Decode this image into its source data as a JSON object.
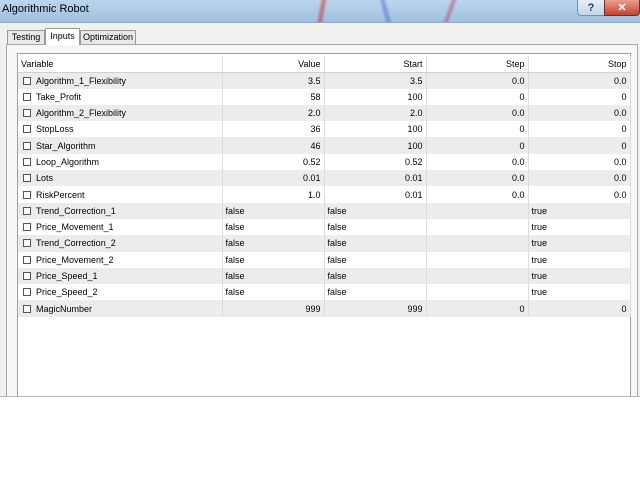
{
  "window": {
    "title": "Algorithmic Robot",
    "help_label": "?",
    "close_label": "✕"
  },
  "tabs": [
    {
      "label": "Testing",
      "active": false
    },
    {
      "label": "Inputs",
      "active": true
    },
    {
      "label": "Optimization",
      "active": false
    }
  ],
  "table": {
    "headers": [
      "Variable",
      "Value",
      "Start",
      "Step",
      "Stop"
    ],
    "rows": [
      {
        "variable": "Algorithm_1_Flexibility",
        "value": "3.5",
        "start": "3.5",
        "step": "0.0",
        "stop": "0.0",
        "numeric": true
      },
      {
        "variable": "Take_Profit",
        "value": "58",
        "start": "100",
        "step": "0",
        "stop": "0",
        "numeric": true
      },
      {
        "variable": "Algorithm_2_Flexibility",
        "value": "2.0",
        "start": "2.0",
        "step": "0.0",
        "stop": "0.0",
        "numeric": true
      },
      {
        "variable": "StopLoss",
        "value": "36",
        "start": "100",
        "step": "0",
        "stop": "0",
        "numeric": true
      },
      {
        "variable": "Star_Algorithm",
        "value": "46",
        "start": "100",
        "step": "0",
        "stop": "0",
        "numeric": true
      },
      {
        "variable": "Loop_Algorithm",
        "value": "0.52",
        "start": "0.52",
        "step": "0.0",
        "stop": "0.0",
        "numeric": true
      },
      {
        "variable": "Lots",
        "value": "0.01",
        "start": "0.01",
        "step": "0.0",
        "stop": "0.0",
        "numeric": true
      },
      {
        "variable": "RiskPercent",
        "value": "1.0",
        "start": "0.01",
        "step": "0.0",
        "stop": "0.0",
        "numeric": true
      },
      {
        "variable": "Trend_Correction_1",
        "value": "false",
        "start": "false",
        "step": "",
        "stop": "true",
        "numeric": false
      },
      {
        "variable": "Price_Movement_1",
        "value": "false",
        "start": "false",
        "step": "",
        "stop": "true",
        "numeric": false
      },
      {
        "variable": "Trend_Correction_2",
        "value": "false",
        "start": "false",
        "step": "",
        "stop": "true",
        "numeric": false
      },
      {
        "variable": "Price_Movement_2",
        "value": "false",
        "start": "false",
        "step": "",
        "stop": "true",
        "numeric": false
      },
      {
        "variable": "Price_Speed_1",
        "value": "false",
        "start": "false",
        "step": "",
        "stop": "true",
        "numeric": false
      },
      {
        "variable": "Price_Speed_2",
        "value": "false",
        "start": "false",
        "step": "",
        "stop": "true",
        "numeric": false
      },
      {
        "variable": "MagicNumber",
        "value": "999",
        "start": "999",
        "step": "0",
        "stop": "0",
        "numeric": true
      }
    ]
  }
}
